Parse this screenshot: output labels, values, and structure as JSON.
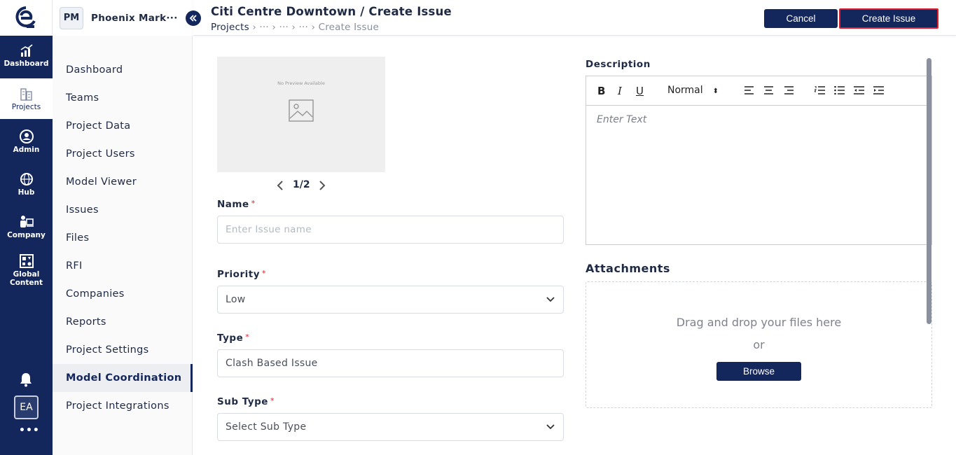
{
  "rail": {
    "items": [
      {
        "label": "Dashboard",
        "icon": "chart-icon"
      },
      {
        "label": "Projects",
        "icon": "buildings-icon"
      },
      {
        "label": "Admin",
        "icon": "admin-gear-icon"
      },
      {
        "label": "Hub",
        "icon": "globe-icon"
      },
      {
        "label": "Company",
        "icon": "company-icon"
      },
      {
        "label": "Global Content",
        "icon": "shapes-icon"
      }
    ],
    "avatar": "EA",
    "more": "•••"
  },
  "sidebar": {
    "project_initials": "PM",
    "project_name": "Phoenix Mark···",
    "items": [
      {
        "label": "Dashboard"
      },
      {
        "label": "Teams"
      },
      {
        "label": "Project Data"
      },
      {
        "label": "Project Users"
      },
      {
        "label": "Model Viewer"
      },
      {
        "label": "Issues"
      },
      {
        "label": "Files"
      },
      {
        "label": "RFI"
      },
      {
        "label": "Companies"
      },
      {
        "label": "Reports"
      },
      {
        "label": "Project Settings"
      },
      {
        "label": "Model Coordination"
      },
      {
        "label": "Project Integrations"
      }
    ],
    "active_item": "Model Coordination"
  },
  "header": {
    "title": "Citi Centre Downtown / Create Issue",
    "breadcrumb_first": "Projects",
    "breadcrumb_rest": " › ··· › ··· › ··· › Create Issue",
    "cancel_label": "Cancel",
    "create_label": "Create Issue"
  },
  "preview": {
    "no_preview_text": "No Preview Available",
    "pager": "1/2"
  },
  "form": {
    "name_label": "Name",
    "name_placeholder": "Enter Issue name",
    "priority_label": "Priority",
    "priority_value": "Low",
    "type_label": "Type",
    "type_value": "Clash Based Issue",
    "subtype_label": "Sub Type",
    "subtype_value": "Select Sub Type",
    "required_mark": "*"
  },
  "description": {
    "label": "Description",
    "format_value": "Normal",
    "placeholder": "Enter Text"
  },
  "attachments": {
    "label": "Attachments",
    "drop_text": "Drag and drop your files here",
    "or_text": "or",
    "browse_label": "Browse"
  },
  "colors": {
    "brand_navy": "#14275c",
    "required_red": "#e21b2b"
  }
}
